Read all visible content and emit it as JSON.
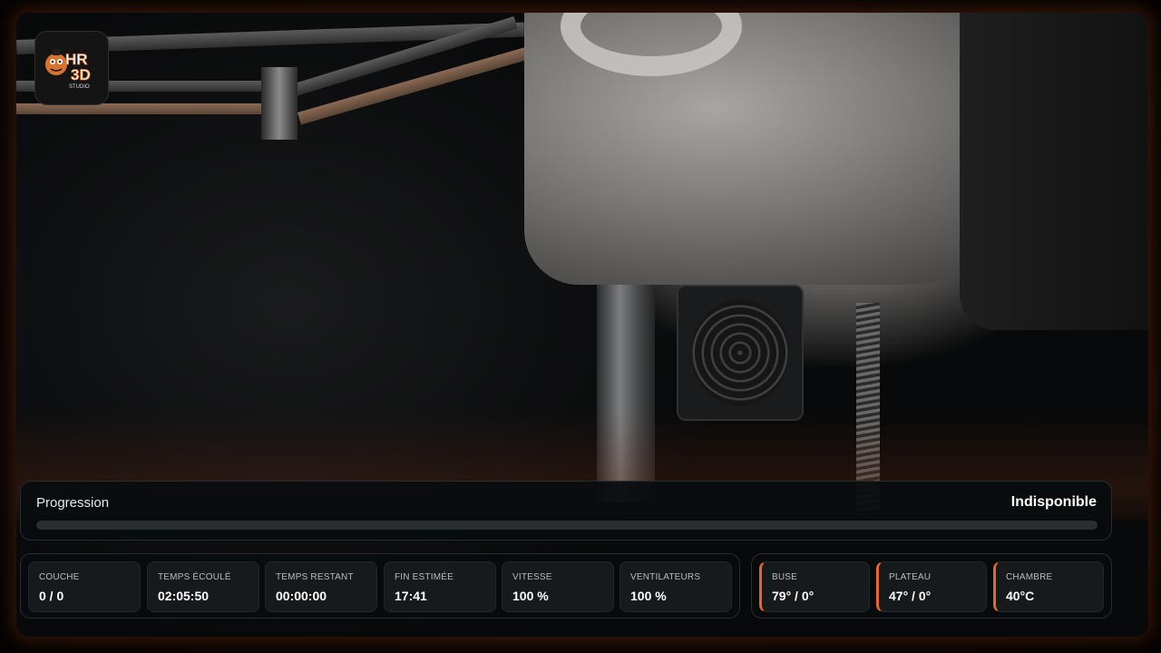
{
  "branding": {
    "logo_text_top": "HR",
    "logo_text_bottom": "3D",
    "logo_subtext": "STUDIO",
    "logo_icon": "mascot-logo-icon"
  },
  "progress": {
    "label": "Progression",
    "status": "Indisponible",
    "fraction": 0
  },
  "stats": [
    {
      "label": "COUCHE",
      "value": "0 / 0"
    },
    {
      "label": "TEMPS ÉCOULÉ",
      "value": "02:05:50"
    },
    {
      "label": "TEMPS RESTANT",
      "value": "00:00:00"
    },
    {
      "label": "FIN ESTIMÉE",
      "value": "17:41"
    },
    {
      "label": "VITESSE",
      "value": "100 %"
    },
    {
      "label": "VENTILATEURS",
      "value": "100 %"
    }
  ],
  "temperatures": [
    {
      "label": "BUSE",
      "value": "79° / 0°"
    },
    {
      "label": "PLATEAU",
      "value": "47° / 0°"
    },
    {
      "label": "CHAMBRE",
      "value": "40°C"
    }
  ],
  "colors": {
    "accent": "#e8662a",
    "panel_bg": "#080c0e",
    "card_bg": "#171a1c"
  }
}
